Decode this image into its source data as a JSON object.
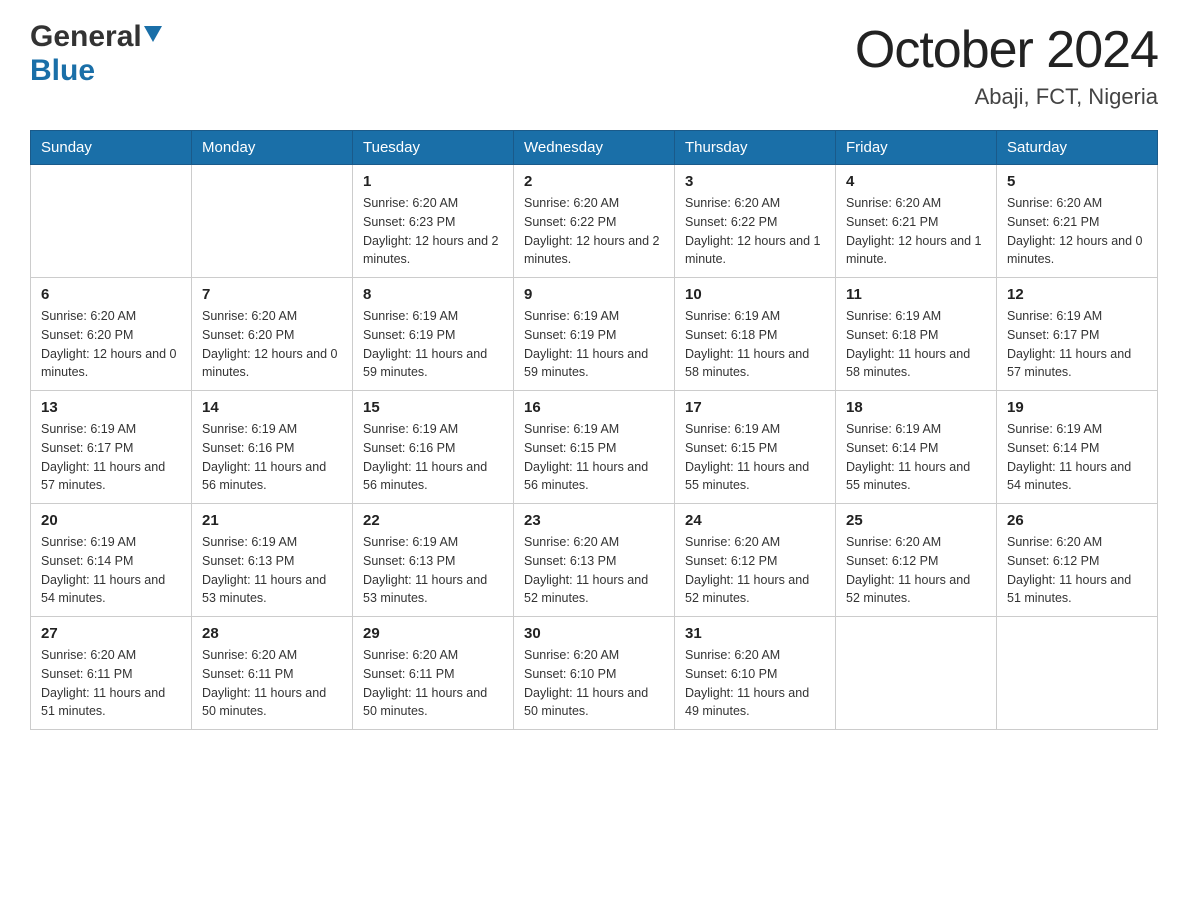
{
  "header": {
    "logo_general": "General",
    "logo_blue": "Blue",
    "month_title": "October 2024",
    "location": "Abaji, FCT, Nigeria"
  },
  "calendar": {
    "days_of_week": [
      "Sunday",
      "Monday",
      "Tuesday",
      "Wednesday",
      "Thursday",
      "Friday",
      "Saturday"
    ],
    "weeks": [
      [
        {
          "date": "",
          "sunrise": "",
          "sunset": "",
          "daylight": ""
        },
        {
          "date": "",
          "sunrise": "",
          "sunset": "",
          "daylight": ""
        },
        {
          "date": "1",
          "sunrise": "Sunrise: 6:20 AM",
          "sunset": "Sunset: 6:23 PM",
          "daylight": "Daylight: 12 hours and 2 minutes."
        },
        {
          "date": "2",
          "sunrise": "Sunrise: 6:20 AM",
          "sunset": "Sunset: 6:22 PM",
          "daylight": "Daylight: 12 hours and 2 minutes."
        },
        {
          "date": "3",
          "sunrise": "Sunrise: 6:20 AM",
          "sunset": "Sunset: 6:22 PM",
          "daylight": "Daylight: 12 hours and 1 minute."
        },
        {
          "date": "4",
          "sunrise": "Sunrise: 6:20 AM",
          "sunset": "Sunset: 6:21 PM",
          "daylight": "Daylight: 12 hours and 1 minute."
        },
        {
          "date": "5",
          "sunrise": "Sunrise: 6:20 AM",
          "sunset": "Sunset: 6:21 PM",
          "daylight": "Daylight: 12 hours and 0 minutes."
        }
      ],
      [
        {
          "date": "6",
          "sunrise": "Sunrise: 6:20 AM",
          "sunset": "Sunset: 6:20 PM",
          "daylight": "Daylight: 12 hours and 0 minutes."
        },
        {
          "date": "7",
          "sunrise": "Sunrise: 6:20 AM",
          "sunset": "Sunset: 6:20 PM",
          "daylight": "Daylight: 12 hours and 0 minutes."
        },
        {
          "date": "8",
          "sunrise": "Sunrise: 6:19 AM",
          "sunset": "Sunset: 6:19 PM",
          "daylight": "Daylight: 11 hours and 59 minutes."
        },
        {
          "date": "9",
          "sunrise": "Sunrise: 6:19 AM",
          "sunset": "Sunset: 6:19 PM",
          "daylight": "Daylight: 11 hours and 59 minutes."
        },
        {
          "date": "10",
          "sunrise": "Sunrise: 6:19 AM",
          "sunset": "Sunset: 6:18 PM",
          "daylight": "Daylight: 11 hours and 58 minutes."
        },
        {
          "date": "11",
          "sunrise": "Sunrise: 6:19 AM",
          "sunset": "Sunset: 6:18 PM",
          "daylight": "Daylight: 11 hours and 58 minutes."
        },
        {
          "date": "12",
          "sunrise": "Sunrise: 6:19 AM",
          "sunset": "Sunset: 6:17 PM",
          "daylight": "Daylight: 11 hours and 57 minutes."
        }
      ],
      [
        {
          "date": "13",
          "sunrise": "Sunrise: 6:19 AM",
          "sunset": "Sunset: 6:17 PM",
          "daylight": "Daylight: 11 hours and 57 minutes."
        },
        {
          "date": "14",
          "sunrise": "Sunrise: 6:19 AM",
          "sunset": "Sunset: 6:16 PM",
          "daylight": "Daylight: 11 hours and 56 minutes."
        },
        {
          "date": "15",
          "sunrise": "Sunrise: 6:19 AM",
          "sunset": "Sunset: 6:16 PM",
          "daylight": "Daylight: 11 hours and 56 minutes."
        },
        {
          "date": "16",
          "sunrise": "Sunrise: 6:19 AM",
          "sunset": "Sunset: 6:15 PM",
          "daylight": "Daylight: 11 hours and 56 minutes."
        },
        {
          "date": "17",
          "sunrise": "Sunrise: 6:19 AM",
          "sunset": "Sunset: 6:15 PM",
          "daylight": "Daylight: 11 hours and 55 minutes."
        },
        {
          "date": "18",
          "sunrise": "Sunrise: 6:19 AM",
          "sunset": "Sunset: 6:14 PM",
          "daylight": "Daylight: 11 hours and 55 minutes."
        },
        {
          "date": "19",
          "sunrise": "Sunrise: 6:19 AM",
          "sunset": "Sunset: 6:14 PM",
          "daylight": "Daylight: 11 hours and 54 minutes."
        }
      ],
      [
        {
          "date": "20",
          "sunrise": "Sunrise: 6:19 AM",
          "sunset": "Sunset: 6:14 PM",
          "daylight": "Daylight: 11 hours and 54 minutes."
        },
        {
          "date": "21",
          "sunrise": "Sunrise: 6:19 AM",
          "sunset": "Sunset: 6:13 PM",
          "daylight": "Daylight: 11 hours and 53 minutes."
        },
        {
          "date": "22",
          "sunrise": "Sunrise: 6:19 AM",
          "sunset": "Sunset: 6:13 PM",
          "daylight": "Daylight: 11 hours and 53 minutes."
        },
        {
          "date": "23",
          "sunrise": "Sunrise: 6:20 AM",
          "sunset": "Sunset: 6:13 PM",
          "daylight": "Daylight: 11 hours and 52 minutes."
        },
        {
          "date": "24",
          "sunrise": "Sunrise: 6:20 AM",
          "sunset": "Sunset: 6:12 PM",
          "daylight": "Daylight: 11 hours and 52 minutes."
        },
        {
          "date": "25",
          "sunrise": "Sunrise: 6:20 AM",
          "sunset": "Sunset: 6:12 PM",
          "daylight": "Daylight: 11 hours and 52 minutes."
        },
        {
          "date": "26",
          "sunrise": "Sunrise: 6:20 AM",
          "sunset": "Sunset: 6:12 PM",
          "daylight": "Daylight: 11 hours and 51 minutes."
        }
      ],
      [
        {
          "date": "27",
          "sunrise": "Sunrise: 6:20 AM",
          "sunset": "Sunset: 6:11 PM",
          "daylight": "Daylight: 11 hours and 51 minutes."
        },
        {
          "date": "28",
          "sunrise": "Sunrise: 6:20 AM",
          "sunset": "Sunset: 6:11 PM",
          "daylight": "Daylight: 11 hours and 50 minutes."
        },
        {
          "date": "29",
          "sunrise": "Sunrise: 6:20 AM",
          "sunset": "Sunset: 6:11 PM",
          "daylight": "Daylight: 11 hours and 50 minutes."
        },
        {
          "date": "30",
          "sunrise": "Sunrise: 6:20 AM",
          "sunset": "Sunset: 6:10 PM",
          "daylight": "Daylight: 11 hours and 50 minutes."
        },
        {
          "date": "31",
          "sunrise": "Sunrise: 6:20 AM",
          "sunset": "Sunset: 6:10 PM",
          "daylight": "Daylight: 11 hours and 49 minutes."
        },
        {
          "date": "",
          "sunrise": "",
          "sunset": "",
          "daylight": ""
        },
        {
          "date": "",
          "sunrise": "",
          "sunset": "",
          "daylight": ""
        }
      ]
    ]
  }
}
